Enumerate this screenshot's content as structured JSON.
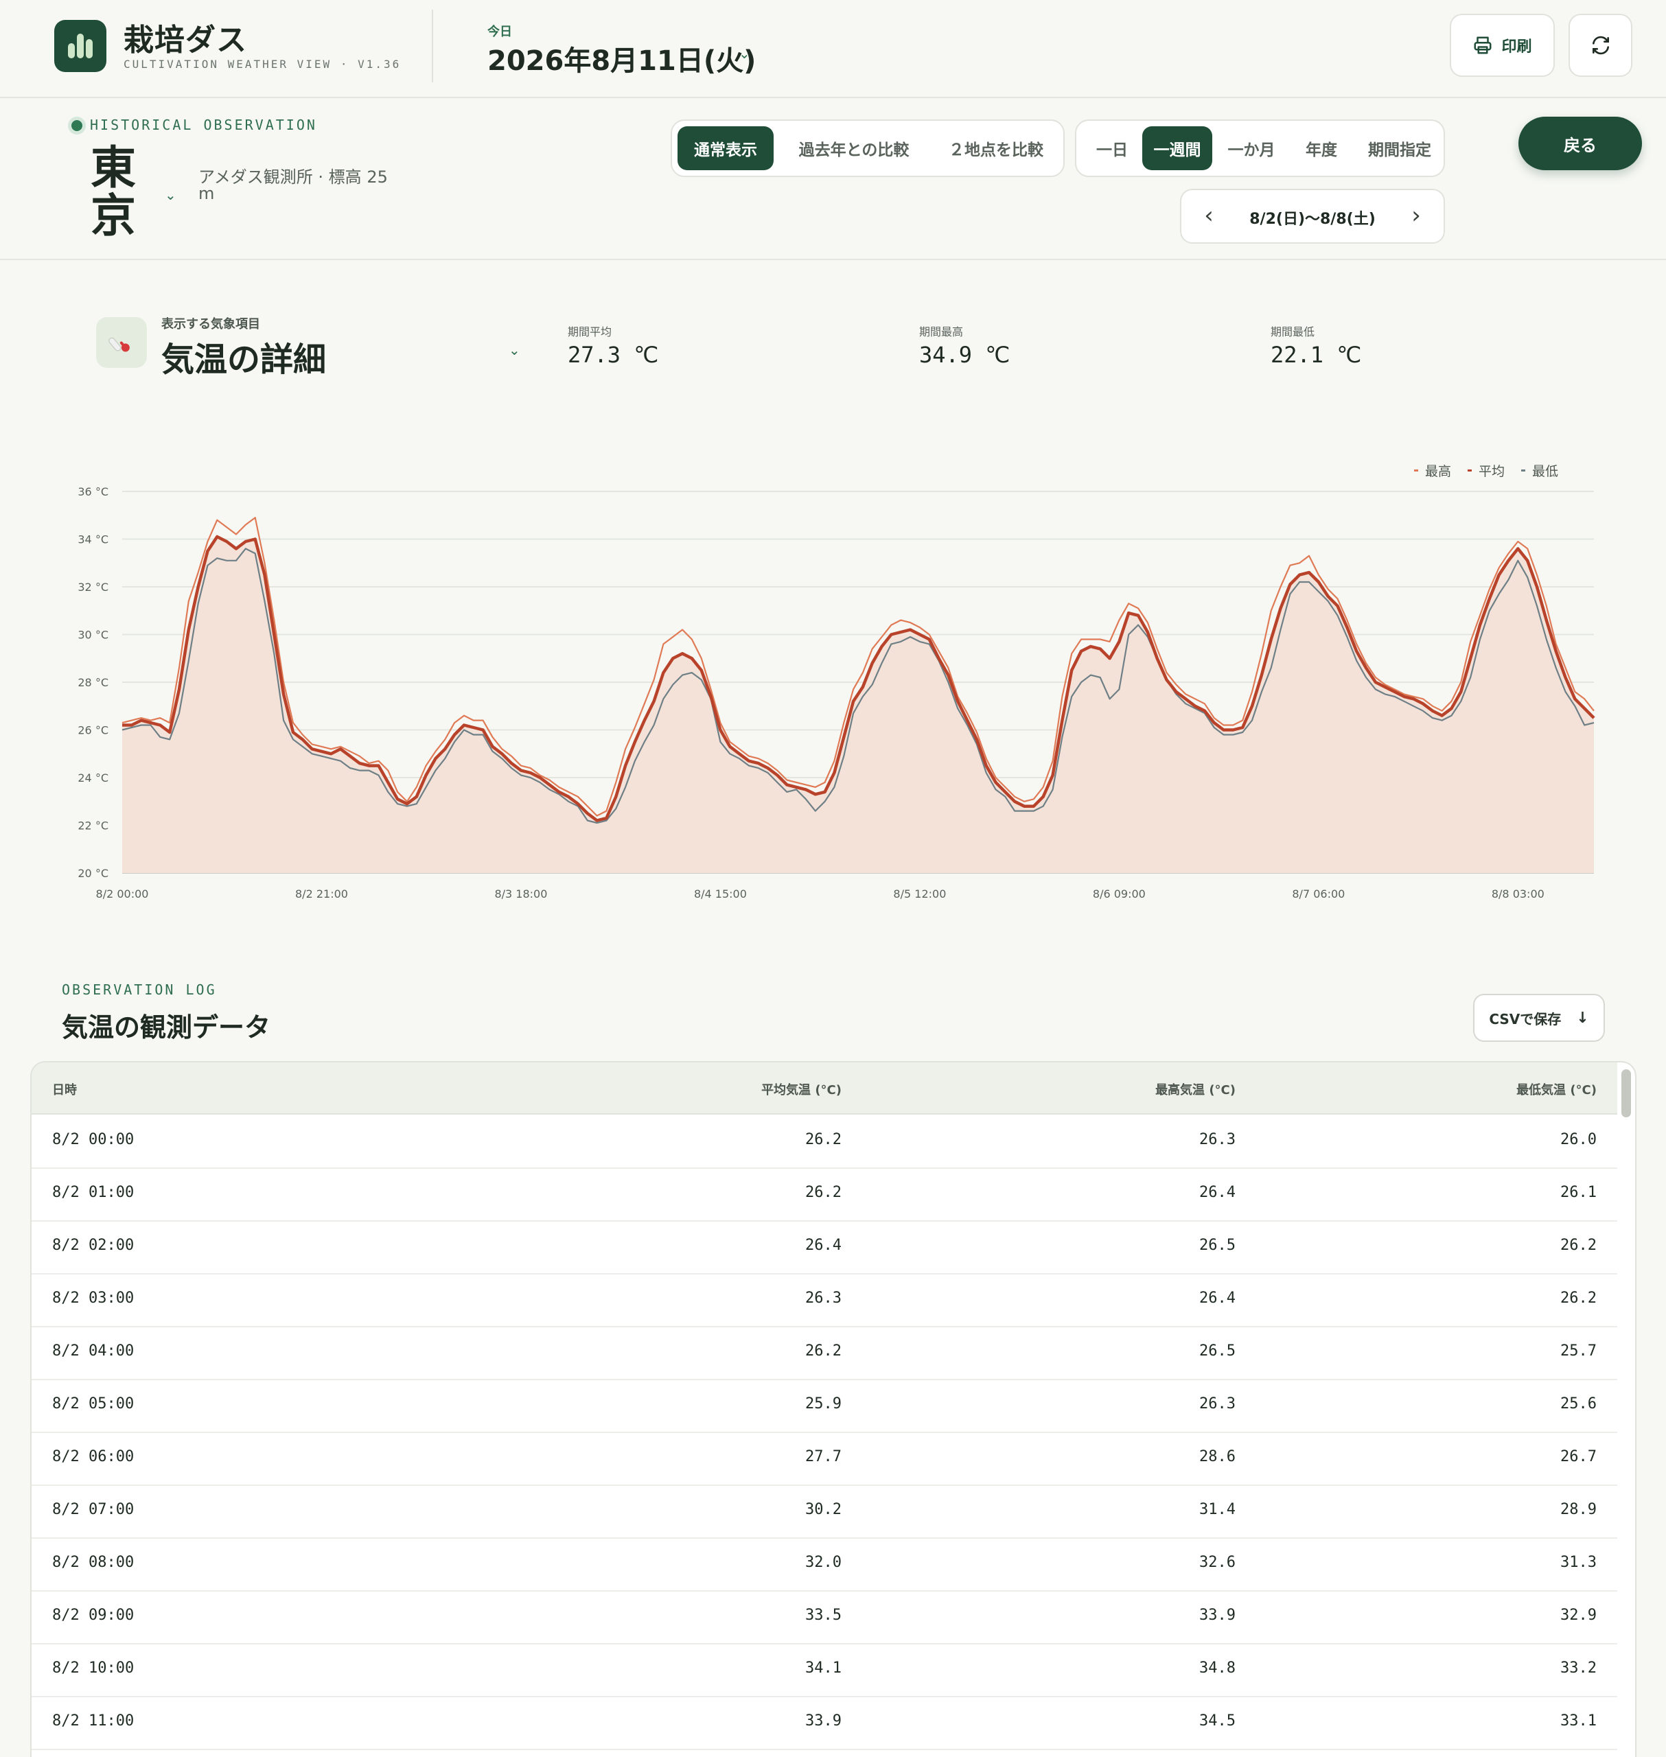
{
  "header": {
    "app_title": "栽培ダス",
    "app_subtitle": "CULTIVATION WEATHER VIEW · V1.36",
    "today_label": "今日",
    "today_date": "2026年8月11日(火)",
    "print_label": "印刷"
  },
  "location": {
    "section_label": "HISTORICAL OBSERVATION",
    "city": "東京",
    "station": "アメダス観測所 · 標高 25 m"
  },
  "mode_tabs": [
    {
      "label": "通常表示",
      "active": true
    },
    {
      "label": "過去年との比較",
      "active": false
    },
    {
      "label": "２地点を比較",
      "active": false
    }
  ],
  "range_tabs": [
    {
      "label": "一日",
      "active": false
    },
    {
      "label": "一週間",
      "active": true
    },
    {
      "label": "一か月",
      "active": false
    },
    {
      "label": "年度",
      "active": false
    },
    {
      "label": "期間指定",
      "active": false
    }
  ],
  "back_label": "戻る",
  "period": {
    "label": "8/2(日)〜8/8(土)"
  },
  "metric": {
    "small_label": "表示する気象項目",
    "name": "気温の詳細"
  },
  "stats": [
    {
      "label": "期間平均",
      "value": "27.3 ℃"
    },
    {
      "label": "期間最高",
      "value": "34.9 ℃"
    },
    {
      "label": "期間最低",
      "value": "22.1 ℃"
    }
  ],
  "colors": {
    "accent": "#1f4d37",
    "max_line": "#e07a55",
    "avg_line": "#b8432a",
    "min_line": "#6e7f86",
    "area_fill": "#f4e2d8"
  },
  "chart_data": {
    "type": "line",
    "ylim": [
      20,
      36
    ],
    "yticks": [
      "20 °C",
      "22 °C",
      "24 °C",
      "26 °C",
      "28 °C",
      "30 °C",
      "32 °C",
      "34 °C",
      "36 °C"
    ],
    "xticks": [
      "8/2 00:00",
      "8/2 21:00",
      "8/3 18:00",
      "8/4 15:00",
      "8/5 12:00",
      "8/6 09:00",
      "8/7 06:00",
      "8/8 03:00"
    ],
    "legend": [
      "最高",
      "平均",
      "最低"
    ],
    "legend_position": "top-right",
    "grid": true,
    "series": [
      {
        "name": "平均",
        "values": [
          26.2,
          26.2,
          26.4,
          26.3,
          26.2,
          25.9,
          27.7,
          30.2,
          32.0,
          33.5,
          34.1,
          33.9,
          33.6,
          33.9,
          34.0,
          32.5,
          30.0,
          27.5,
          25.9,
          25.6,
          25.2,
          25.1,
          25.0,
          25.2,
          24.9,
          24.6,
          24.5,
          24.5,
          23.8,
          23.1,
          22.9,
          23.2,
          24.1,
          24.8,
          25.2,
          25.8,
          26.2,
          26.1,
          26.0,
          25.3,
          25.0,
          24.6,
          24.3,
          24.2,
          24.0,
          23.7,
          23.4,
          23.2,
          22.9,
          22.5,
          22.2,
          22.3,
          23.2,
          24.5,
          25.5,
          26.4,
          27.2,
          28.4,
          29.0,
          29.2,
          29.0,
          28.5,
          27.4,
          26.0,
          25.3,
          25.0,
          24.7,
          24.6,
          24.4,
          24.1,
          23.7,
          23.6,
          23.5,
          23.3,
          23.4,
          24.2,
          25.7,
          27.2,
          27.8,
          28.8,
          29.5,
          30.0,
          30.1,
          30.2,
          30.0,
          29.8,
          29.0,
          28.3,
          27.2,
          26.4,
          25.6,
          24.5,
          23.8,
          23.4,
          23.0,
          22.8,
          22.8,
          23.2,
          24.1,
          26.4,
          28.5,
          29.3,
          29.5,
          29.4,
          29.0,
          29.7,
          30.9,
          30.8,
          30.1,
          29.0,
          28.1,
          27.6,
          27.3,
          27.0,
          26.8,
          26.3,
          26.0,
          26.0,
          26.1,
          27.0,
          28.3,
          29.8,
          31.1,
          32.1,
          32.5,
          32.6,
          32.2,
          31.6,
          31.2,
          30.3,
          29.3,
          28.6,
          28.0,
          27.8,
          27.6,
          27.4,
          27.3,
          27.1,
          26.8,
          26.6,
          26.9,
          27.6,
          29.0,
          30.4,
          31.5,
          32.5,
          33.1,
          33.6,
          33.1,
          32.0,
          30.6,
          29.3,
          28.2,
          27.3,
          26.9,
          26.5
        ],
        "color": "#b8432a"
      },
      {
        "name": "最高",
        "values": [
          26.3,
          26.4,
          26.5,
          26.4,
          26.5,
          26.3,
          28.6,
          31.4,
          32.6,
          33.9,
          34.8,
          34.5,
          34.2,
          34.6,
          34.9,
          33.0,
          30.6,
          28.0,
          26.3,
          25.8,
          25.4,
          25.3,
          25.2,
          25.3,
          25.1,
          24.9,
          24.6,
          24.7,
          24.3,
          23.4,
          23.0,
          23.6,
          24.5,
          25.1,
          25.6,
          26.3,
          26.6,
          26.4,
          26.4,
          25.7,
          25.2,
          24.9,
          24.5,
          24.4,
          24.1,
          23.9,
          23.6,
          23.4,
          23.2,
          22.8,
          22.4,
          22.6,
          23.8,
          25.2,
          26.1,
          27.1,
          28.1,
          29.6,
          29.9,
          30.2,
          29.8,
          29.0,
          27.7,
          26.3,
          25.5,
          25.2,
          24.9,
          24.8,
          24.6,
          24.3,
          23.9,
          23.8,
          23.7,
          23.6,
          23.8,
          24.7,
          26.3,
          27.7,
          28.4,
          29.4,
          29.9,
          30.4,
          30.6,
          30.5,
          30.3,
          30.0,
          29.3,
          28.6,
          27.4,
          26.7,
          25.9,
          24.8,
          24.0,
          23.6,
          23.2,
          23.0,
          23.1,
          23.6,
          24.7,
          27.4,
          29.2,
          29.8,
          29.8,
          29.8,
          29.7,
          30.6,
          31.3,
          31.1,
          30.5,
          29.4,
          28.4,
          27.9,
          27.5,
          27.3,
          27.1,
          26.5,
          26.2,
          26.2,
          26.4,
          27.6,
          29.2,
          31.0,
          32.0,
          32.9,
          33.0,
          33.3,
          32.5,
          31.9,
          31.5,
          30.6,
          29.6,
          28.8,
          28.2,
          27.9,
          27.7,
          27.5,
          27.4,
          27.3,
          27.0,
          26.8,
          27.2,
          28.0,
          29.7,
          30.8,
          31.9,
          32.8,
          33.4,
          33.9,
          33.6,
          32.5,
          31.2,
          29.6,
          28.6,
          27.6,
          27.3,
          26.8
        ],
        "color": "#e07a55"
      },
      {
        "name": "最低",
        "values": [
          26.0,
          26.1,
          26.2,
          26.2,
          25.7,
          25.6,
          26.7,
          28.9,
          31.3,
          32.9,
          33.2,
          33.1,
          33.1,
          33.6,
          33.4,
          31.4,
          29.2,
          26.4,
          25.6,
          25.3,
          25.0,
          24.9,
          24.8,
          24.7,
          24.4,
          24.3,
          24.3,
          24.1,
          23.4,
          22.9,
          22.8,
          22.9,
          23.6,
          24.3,
          24.8,
          25.5,
          26.0,
          25.8,
          25.8,
          25.1,
          24.8,
          24.4,
          24.1,
          24.0,
          23.8,
          23.5,
          23.3,
          23.0,
          22.8,
          22.2,
          22.1,
          22.2,
          22.7,
          23.6,
          24.7,
          25.5,
          26.2,
          27.3,
          27.9,
          28.3,
          28.4,
          28.1,
          27.3,
          25.5,
          25.0,
          24.8,
          24.5,
          24.4,
          24.2,
          23.8,
          23.4,
          23.5,
          23.1,
          22.6,
          23.0,
          23.6,
          24.9,
          26.7,
          27.4,
          27.9,
          28.8,
          29.6,
          29.7,
          29.9,
          29.7,
          29.6,
          28.9,
          28.0,
          26.9,
          26.2,
          25.4,
          24.2,
          23.5,
          23.2,
          22.6,
          22.6,
          22.6,
          22.8,
          23.5,
          25.7,
          27.4,
          28.0,
          28.3,
          28.2,
          27.3,
          27.7,
          30.0,
          30.4,
          29.9,
          29.0,
          28.1,
          27.5,
          27.1,
          26.9,
          26.7,
          26.1,
          25.8,
          25.8,
          25.9,
          26.4,
          27.6,
          28.6,
          30.2,
          31.7,
          32.2,
          32.2,
          31.8,
          31.4,
          30.8,
          29.9,
          28.9,
          28.2,
          27.7,
          27.5,
          27.4,
          27.2,
          27.0,
          26.8,
          26.5,
          26.4,
          26.6,
          27.2,
          28.2,
          29.8,
          31.0,
          31.7,
          32.3,
          33.1,
          32.4,
          31.2,
          29.8,
          28.6,
          27.6,
          27.0,
          26.2,
          26.3
        ],
        "color": "#6e7f86"
      }
    ]
  },
  "log": {
    "section_label": "OBSERVATION LOG",
    "title": "気温の観測データ",
    "csv_label": "CSVで保存",
    "columns": [
      "日時",
      "平均気温 (°C)",
      "最高気温 (°C)",
      "最低気温 (°C)"
    ],
    "rows": [
      [
        "8/2 00:00",
        "26.2",
        "26.3",
        "26.0"
      ],
      [
        "8/2 01:00",
        "26.2",
        "26.4",
        "26.1"
      ],
      [
        "8/2 02:00",
        "26.4",
        "26.5",
        "26.2"
      ],
      [
        "8/2 03:00",
        "26.3",
        "26.4",
        "26.2"
      ],
      [
        "8/2 04:00",
        "26.2",
        "26.5",
        "25.7"
      ],
      [
        "8/2 05:00",
        "25.9",
        "26.3",
        "25.6"
      ],
      [
        "8/2 06:00",
        "27.7",
        "28.6",
        "26.7"
      ],
      [
        "8/2 07:00",
        "30.2",
        "31.4",
        "28.9"
      ],
      [
        "8/2 08:00",
        "32.0",
        "32.6",
        "31.3"
      ],
      [
        "8/2 09:00",
        "33.5",
        "33.9",
        "32.9"
      ],
      [
        "8/2 10:00",
        "34.1",
        "34.8",
        "33.2"
      ],
      [
        "8/2 11:00",
        "33.9",
        "34.5",
        "33.1"
      ]
    ]
  }
}
